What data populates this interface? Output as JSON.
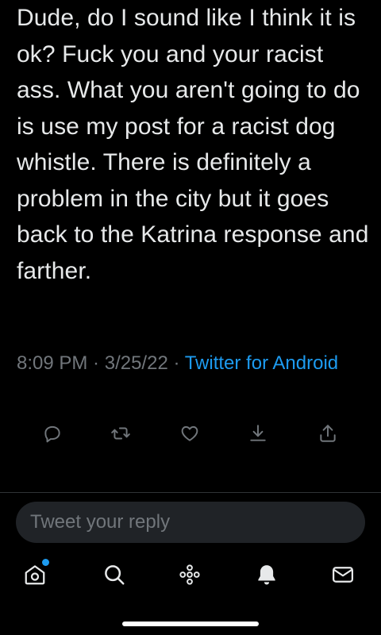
{
  "tweet": {
    "text": "Dude, do I sound like I think it is ok? Fuck you and your racist ass. What you aren't going to do is use my post for a racist dog whistle. There is definitely a problem in the city but it goes back to the Katrina response and farther.",
    "time": "8:09 PM",
    "separator1": " · ",
    "date": "3/25/22",
    "separator2": " · ",
    "source": "Twitter for Android"
  },
  "actions": [
    "reply-icon",
    "retweet-icon",
    "like-icon",
    "download-icon",
    "share-icon"
  ],
  "reply": {
    "placeholder": "Tweet your reply"
  },
  "nav": {
    "items": [
      "home-icon",
      "search-icon",
      "spaces-icon",
      "notifications-icon",
      "messages-icon"
    ],
    "home_has_new": true
  },
  "colors": {
    "background": "#000000",
    "text": "#e7e9ea",
    "muted": "#71767b",
    "accent": "#1d9bf0"
  }
}
